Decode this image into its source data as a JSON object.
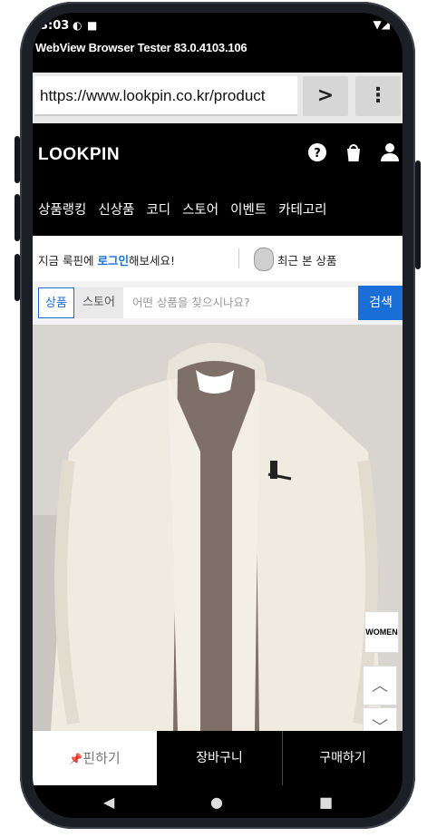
{
  "status_bar": {
    "time": "3:03",
    "icons": [
      "notification-icon",
      "sd-card-icon"
    ],
    "signal": "wifi-battery-icon"
  },
  "app_title": "WebView Browser Tester 83.0.4103.106",
  "browser": {
    "url": "https://www.lookpin.co.kr/product",
    "go_label": ">",
    "menu_label": "⋮"
  },
  "site": {
    "logo": "LOOKPIN",
    "header_icons": [
      "help-icon",
      "shopping-bag-icon",
      "user-icon"
    ],
    "menu": [
      "상품랭킹",
      "신상품",
      "코디",
      "스토어",
      "이벤트",
      "카테고리"
    ]
  },
  "login_bar": {
    "prefix": "지금 룩핀에 ",
    "login_link": "로그인",
    "suffix": "해보세요!",
    "recent": "최근 본 상품"
  },
  "search": {
    "tab_product": "상품",
    "tab_store": "스토어",
    "placeholder": "어떤 상품을 찾으시나요?",
    "button": "검색"
  },
  "side_buttons": {
    "women": "WOMEN"
  },
  "actions": {
    "pin": "핀하기",
    "cart": "장바구니",
    "buy": "구매하기"
  },
  "colors": {
    "accent": "#1a6fd6",
    "header_bg": "#000000"
  }
}
